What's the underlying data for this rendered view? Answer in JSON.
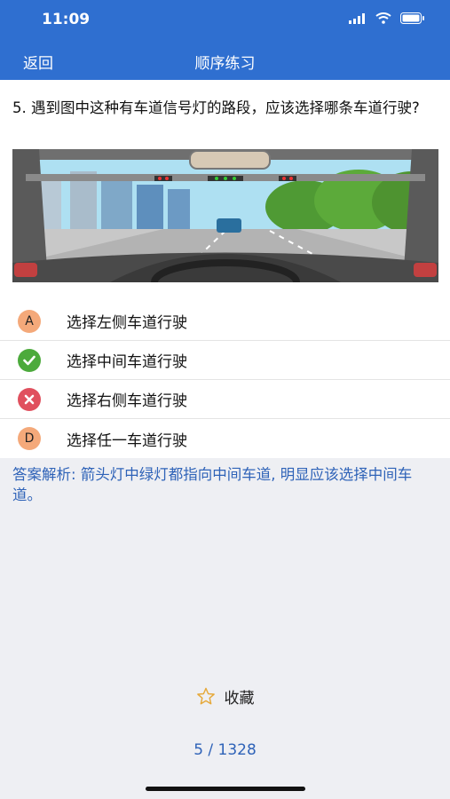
{
  "status": {
    "time": "11:09"
  },
  "nav": {
    "back_label": "返回",
    "title": "顺序练习"
  },
  "question": {
    "text": "5. 遇到图中这种有车道信号灯的路段，应该选择哪条车道行驶?"
  },
  "options": [
    {
      "badge": "A",
      "state": "letter",
      "text": "选择左侧车道行驶"
    },
    {
      "badge": "",
      "state": "correct",
      "text": "选择中间车道行驶"
    },
    {
      "badge": "",
      "state": "wrong",
      "text": "选择右侧车道行驶"
    },
    {
      "badge": "D",
      "state": "letter",
      "text": "选择任一车道行驶"
    }
  ],
  "analysis": {
    "text": "答案解析: 箭头灯中绿灯都指向中间车道, 明显应该选择中间车道。"
  },
  "favorite": {
    "label": "收藏",
    "icon": "star-outline-icon"
  },
  "pager": {
    "text": "5 / 1328"
  },
  "colors": {
    "header": "#2f6fd0",
    "accent_text": "#2f63b8",
    "correct": "#4caa3c",
    "wrong": "#e0505e",
    "letter_badge": "#f4a97a"
  }
}
